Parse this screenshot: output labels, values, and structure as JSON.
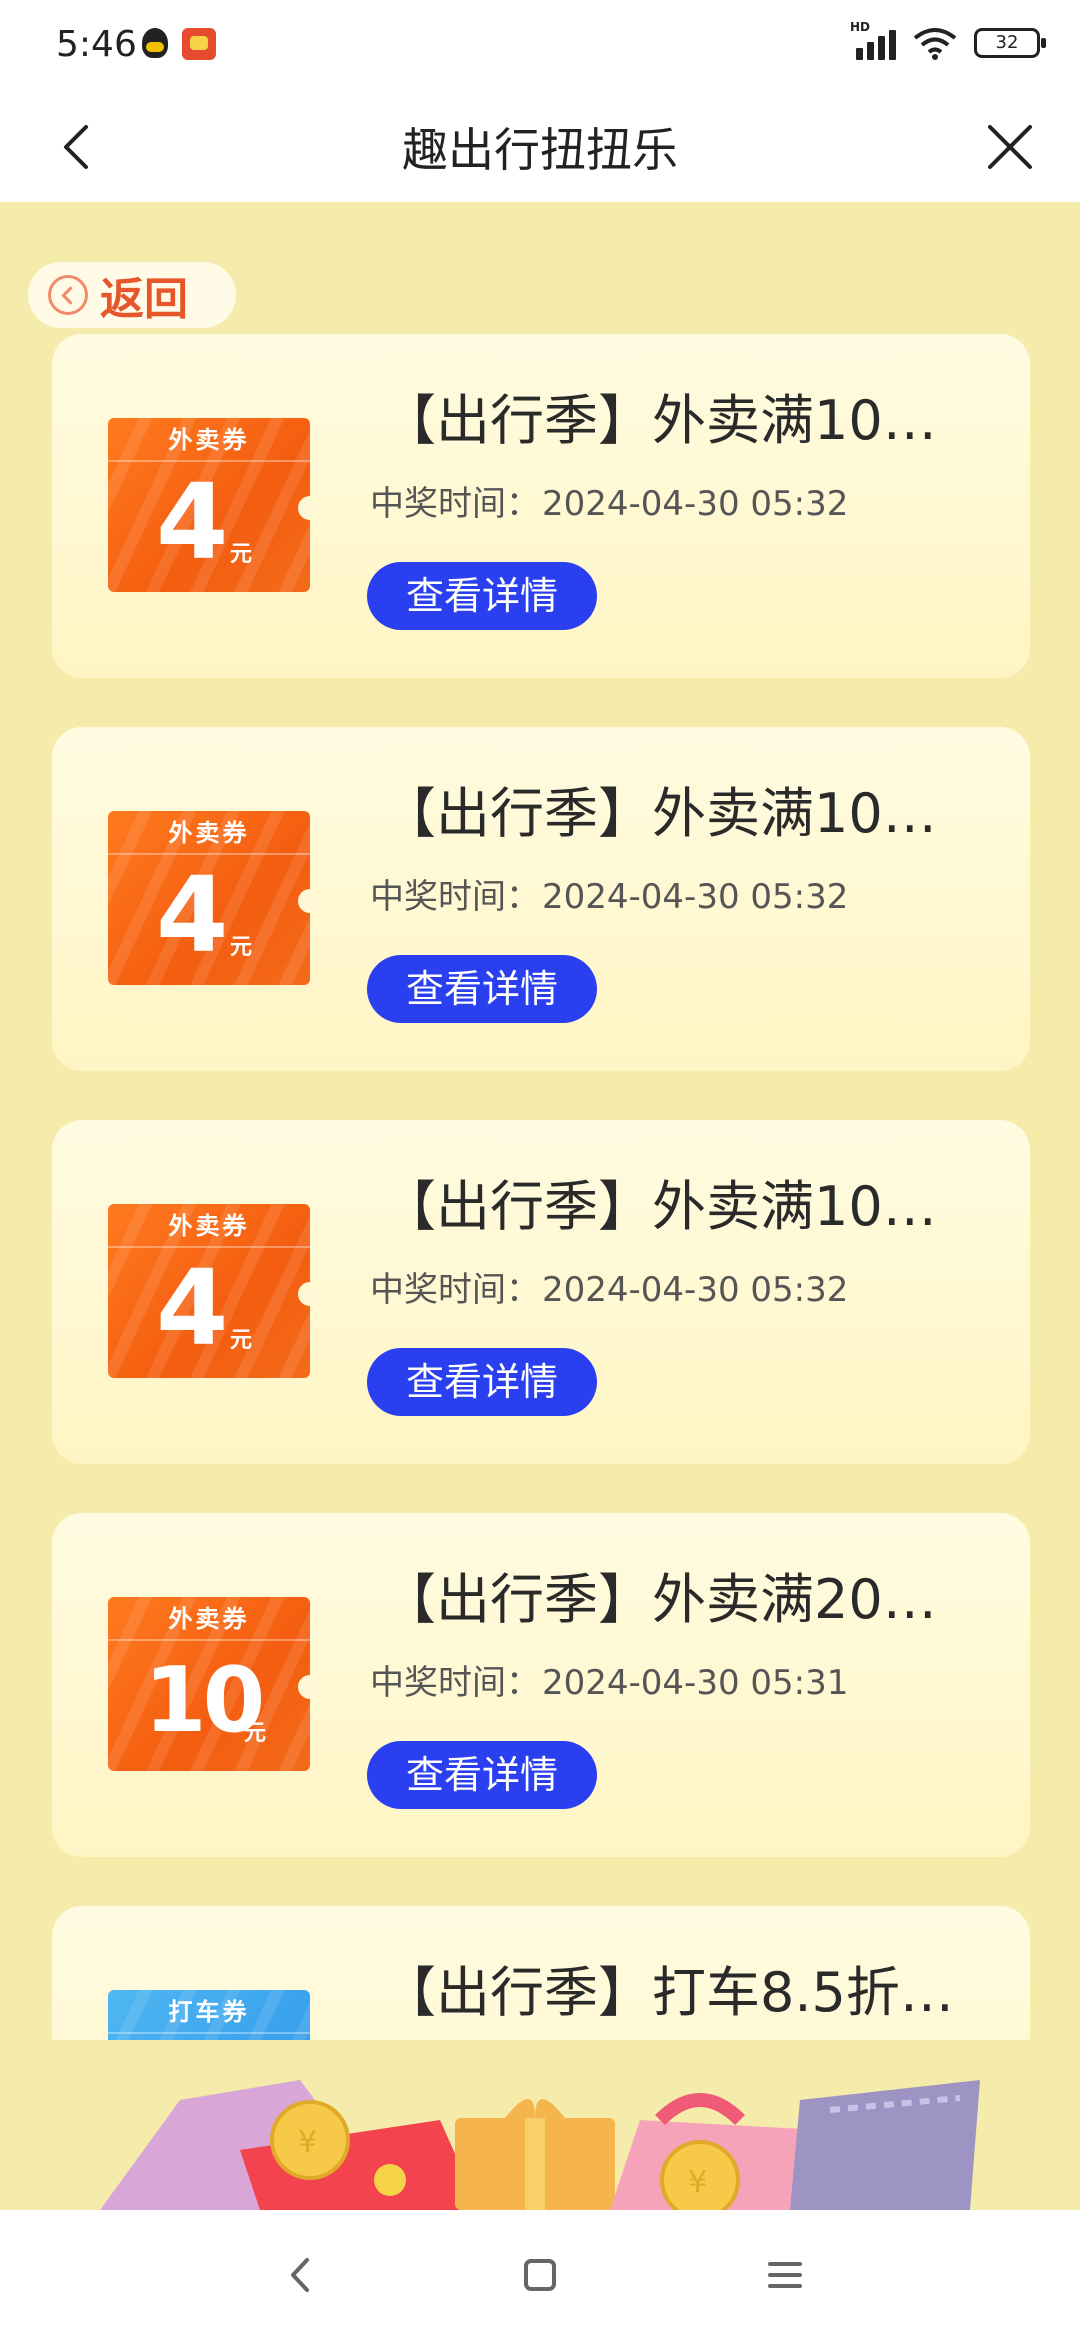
{
  "status_bar": {
    "time": "5:46",
    "network": "HD",
    "battery": "32"
  },
  "title_bar": {
    "title": "趣出行扭扭乐"
  },
  "back_pill": {
    "label": "返回"
  },
  "cards": [
    {
      "title": "【出行季】外卖满10…",
      "time_label": "中奖时间：",
      "time": "2024-04-30 05:32",
      "button": "查看详情",
      "coupon_type": "外卖券",
      "coupon_value": "4",
      "coupon_unit": "元",
      "coupon_color": "#f45d10"
    },
    {
      "title": "【出行季】外卖满10…",
      "time_label": "中奖时间：",
      "time": "2024-04-30 05:32",
      "button": "查看详情",
      "coupon_type": "外卖券",
      "coupon_value": "4",
      "coupon_unit": "元",
      "coupon_color": "#f45d10"
    },
    {
      "title": "【出行季】外卖满10…",
      "time_label": "中奖时间：",
      "time": "2024-04-30 05:32",
      "button": "查看详情",
      "coupon_type": "外卖券",
      "coupon_value": "4",
      "coupon_unit": "元",
      "coupon_color": "#f45d10"
    },
    {
      "title": "【出行季】外卖满20…",
      "time_label": "中奖时间：",
      "time": "2024-04-30 05:31",
      "button": "查看详情",
      "coupon_type": "外卖券",
      "coupon_value": "10",
      "coupon_unit": "元",
      "coupon_color": "#f45d10"
    },
    {
      "title": "【出行季】打车8.5折…",
      "coupon_type": "打车券",
      "coupon_color": "#2b92e8"
    }
  ],
  "colors": {
    "page_bg": "#f5ecac",
    "button_bg": "#2a3ff0",
    "back_accent": "#e6562a"
  }
}
